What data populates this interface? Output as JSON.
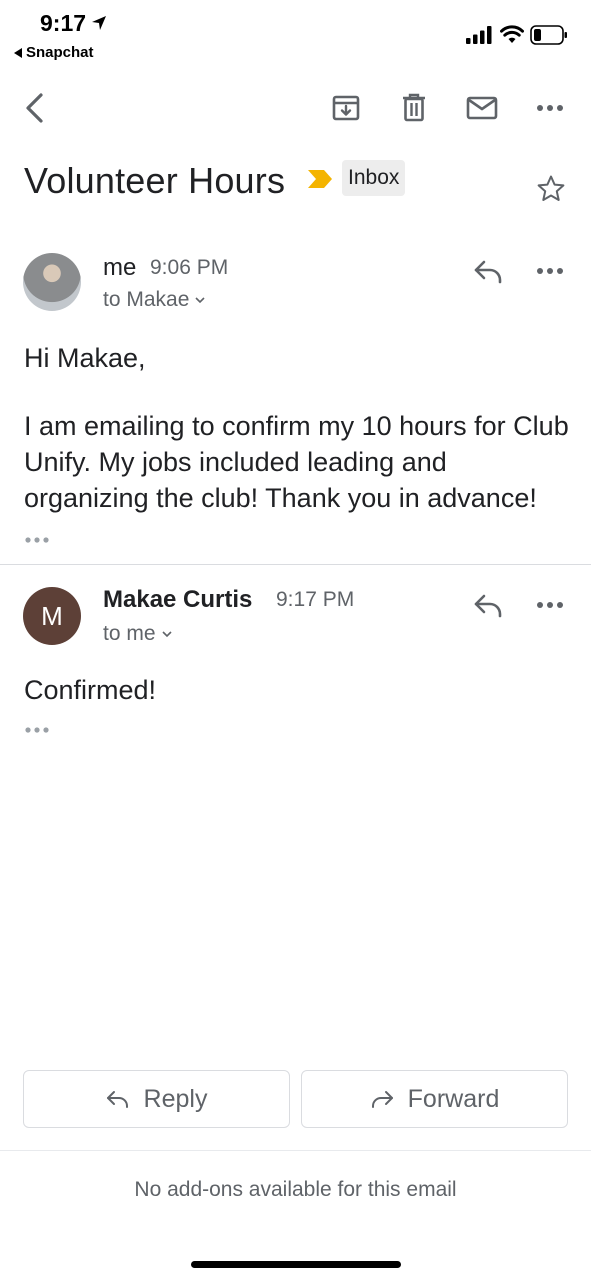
{
  "status_bar": {
    "time": "9:17",
    "back_app": "Snapchat"
  },
  "toolbar": {
    "icons": [
      "back-chevron-icon",
      "archive-icon",
      "trash-icon",
      "mail-icon",
      "more-icon"
    ]
  },
  "email": {
    "subject": "Volunteer Hours",
    "label": "Inbox",
    "important_color": "#f4b400"
  },
  "messages": [
    {
      "sender": "me",
      "time": "9:06 PM",
      "recipient": "to Makae",
      "avatar": "photo",
      "greeting": "Hi Makae,",
      "body": "I am emailing to confirm my 10 hours for Club Unify. My jobs included leading and organizing the club! Thank you in advance!"
    },
    {
      "sender": "Makae Curtis",
      "time": "9:17 PM",
      "recipient": "to me",
      "avatar_letter": "M",
      "avatar_color": "#5d4037",
      "body": "Confirmed!"
    }
  ],
  "actions": {
    "reply_label": "Reply",
    "forward_label": "Forward"
  },
  "footer": {
    "addons_text": "No add-ons available for this email"
  }
}
